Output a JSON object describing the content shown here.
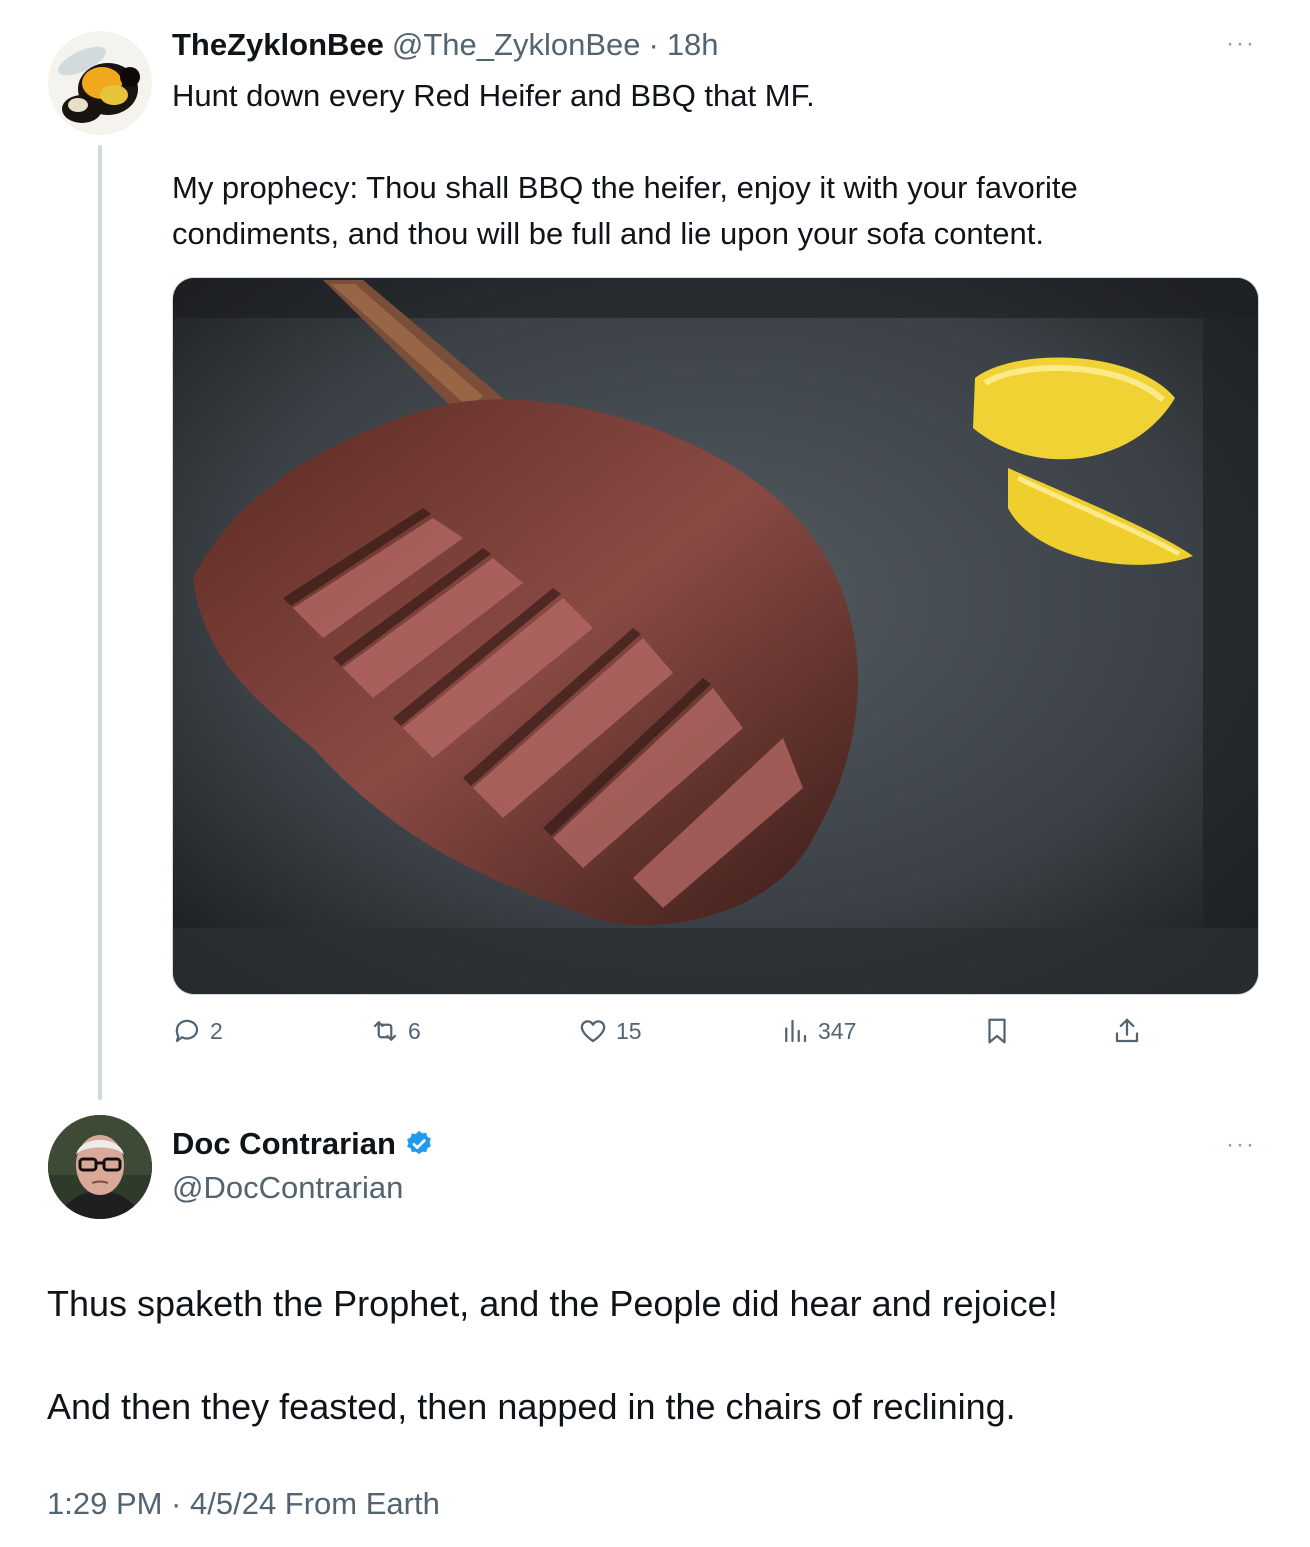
{
  "tweet": {
    "author_name": "TheZyklonBee",
    "handle": "@The_ZyklonBee",
    "separator": "·",
    "time": "18h",
    "more_label": "···",
    "text_line1": "Hunt down every Red Heifer and BBQ that MF.",
    "text_line2": "My prophecy: Thou shall BBQ the heifer, enjoy it with your favorite",
    "text_line3": "condiments, and thou will be full and lie upon your sofa content.",
    "media_alt": "Sliced grilled tomahawk steak on slate with lemon wedges",
    "actions": {
      "replies": "2",
      "reposts": "6",
      "likes": "15",
      "views": "347"
    }
  },
  "reply": {
    "author_name": "Doc Contrarian",
    "handle": "@DocContrarian",
    "verified_color": "#1d9bf0",
    "more_label": "···",
    "text_line1": "Thus spaketh the Prophet, and the People did hear and rejoice!",
    "text_line2": "And then they feasted, then napped in the chairs of reclining.",
    "meta": "1:29 PM · 4/5/24 From Earth"
  }
}
